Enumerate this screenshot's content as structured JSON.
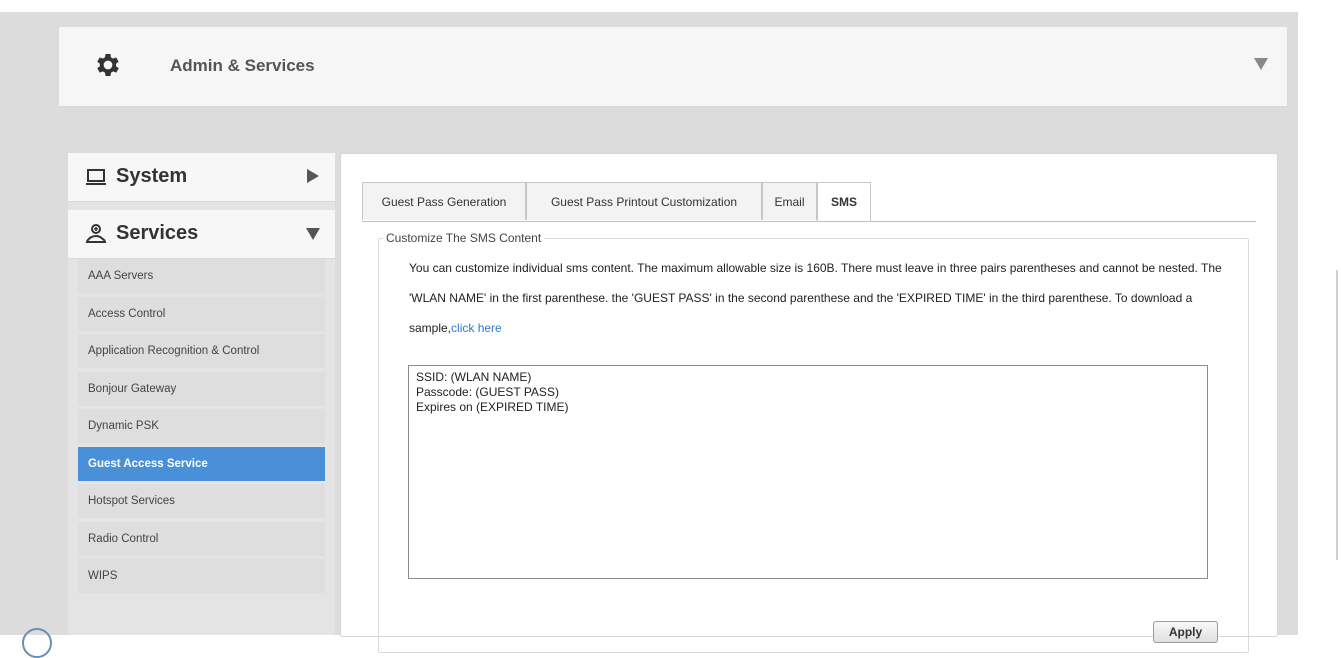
{
  "header": {
    "title": "Admin & Services",
    "icon": "gear-icon",
    "collapse_icon": "caret-down-icon"
  },
  "sidebar": {
    "system": {
      "label": "System",
      "icon": "laptop-icon",
      "arrow": "caret-right-icon"
    },
    "services": {
      "label": "Services",
      "icon": "services-icon",
      "arrow": "caret-down-icon"
    },
    "items": [
      {
        "label": "AAA Servers"
      },
      {
        "label": "Access Control"
      },
      {
        "label": "Application Recognition & Control"
      },
      {
        "label": "Bonjour Gateway"
      },
      {
        "label": "Dynamic PSK"
      },
      {
        "label": "Guest Access Service",
        "active": true
      },
      {
        "label": "Hotspot Services"
      },
      {
        "label": "Radio Control"
      },
      {
        "label": "WIPS"
      }
    ]
  },
  "tabs": [
    {
      "label": "Guest Pass Generation"
    },
    {
      "label": "Guest Pass Printout Customization"
    },
    {
      "label": "Email"
    },
    {
      "label": "SMS",
      "active": true
    }
  ],
  "sms": {
    "legend": "Customize The SMS Content",
    "description": "You can customize individual sms content. The maximum allowable size is 160B. There must leave in three pairs parentheses and cannot be nested. The 'WLAN NAME' in the first parenthese. the 'GUEST PASS' in the second parenthese and the 'EXPIRED TIME' in the third parenthese. To download a sample,",
    "link_text": "click here",
    "content": "SSID: (WLAN NAME)\nPasscode: (GUEST PASS)\nExpires on (EXPIRED TIME)",
    "apply_label": "Apply"
  },
  "colors": {
    "accent": "#4a90d9",
    "link": "#2f7ac7",
    "page_background": "#dcdcdc"
  }
}
